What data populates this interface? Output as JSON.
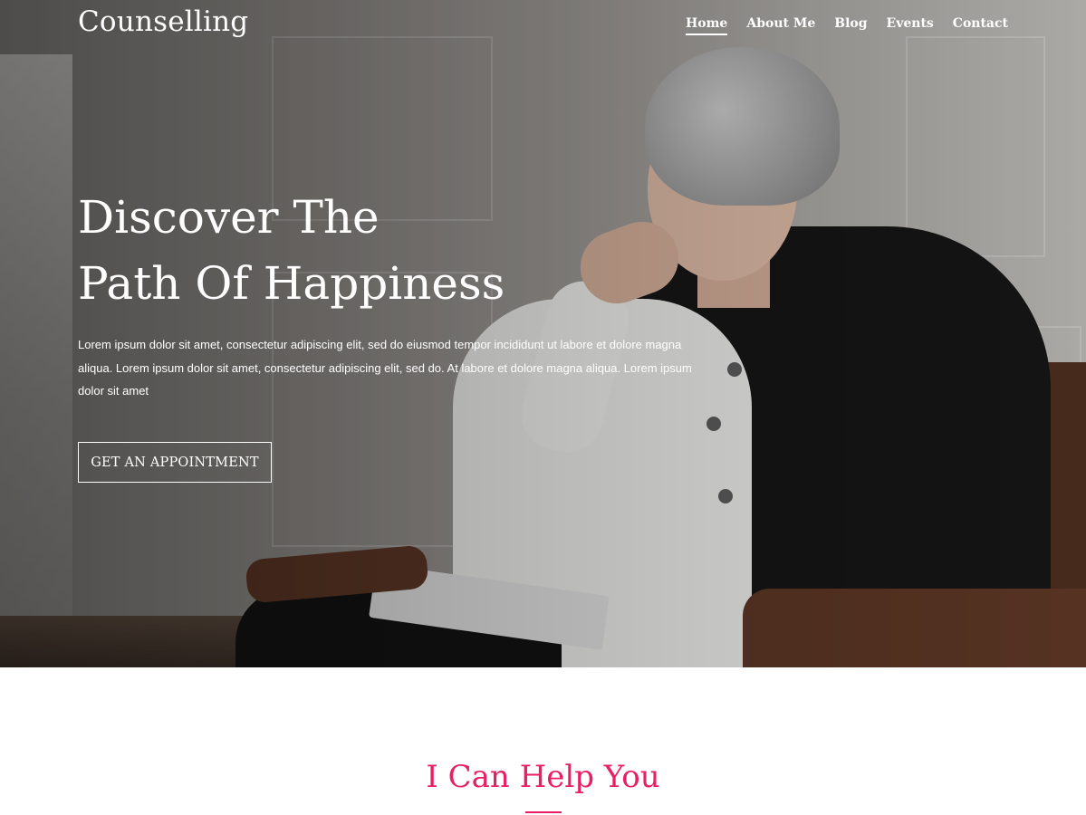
{
  "site": {
    "title": "Counselling"
  },
  "nav": {
    "items": [
      {
        "label": "Home",
        "active": true
      },
      {
        "label": "About Me",
        "active": false
      },
      {
        "label": "Blog",
        "active": false
      },
      {
        "label": "Events",
        "active": false
      },
      {
        "label": "Contact",
        "active": false
      }
    ]
  },
  "hero": {
    "title_line1": "Discover The",
    "title_line2": "Path Of Happiness",
    "text": "Lorem ipsum dolor sit amet, consectetur adipiscing elit, sed do eiusmod tempor incididunt ut labore et dolore magna aliqua. Lorem ipsum dolor sit amet, consectetur adipiscing elit, sed do. At labore et dolore magna aliqua. Lorem ipsum dolor sit amet",
    "cta_label": "GET AN APPOINTMENT",
    "image": "woman-seated-in-armchair-photo"
  },
  "help_section": {
    "title": "I Can Help You"
  },
  "colors": {
    "accent": "#e91e63",
    "hero_text": "#ffffff"
  }
}
